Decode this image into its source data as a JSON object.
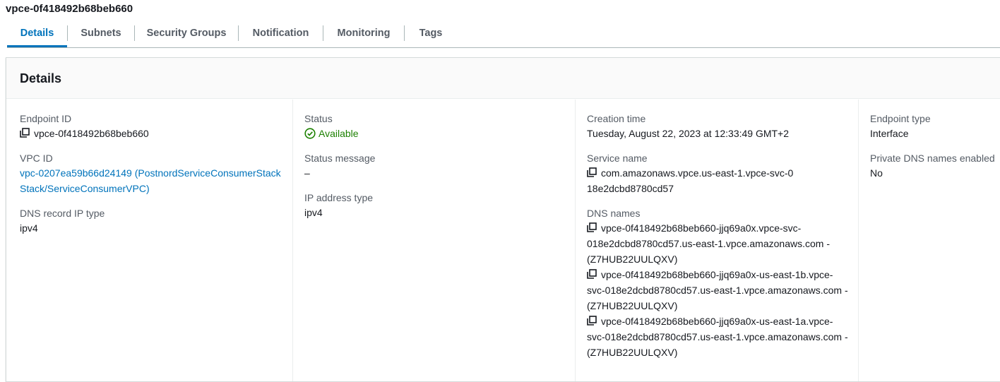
{
  "page": {
    "title": "vpce-0f418492b68beb660"
  },
  "tabs": [
    {
      "label": "Details",
      "active": true
    },
    {
      "label": "Subnets",
      "active": false
    },
    {
      "label": "Security Groups",
      "active": false
    },
    {
      "label": "Notification",
      "active": false
    },
    {
      "label": "Monitoring",
      "active": false
    },
    {
      "label": "Tags",
      "active": false
    }
  ],
  "panel": {
    "heading": "Details"
  },
  "fields": {
    "endpoint_id": {
      "label": "Endpoint ID",
      "value": "vpce-0f418492b68beb660",
      "icon": "copy-icon"
    },
    "vpc_id": {
      "label": "VPC ID",
      "value": "vpc-0207ea59b66d24149 (PostnordServiceConsumerStackStack/ServiceConsumerVPC)"
    },
    "dns_record_ip_type": {
      "label": "DNS record IP type",
      "value": "ipv4"
    },
    "status": {
      "label": "Status",
      "value": "Available",
      "icon": "check-circle-icon",
      "color": "#1d8102"
    },
    "status_message": {
      "label": "Status message",
      "value": "–"
    },
    "ip_address_type": {
      "label": "IP address type",
      "value": "ipv4"
    },
    "creation_time": {
      "label": "Creation time",
      "value": "Tuesday, August 22, 2023 at 12:33:49 GMT+2"
    },
    "service_name": {
      "label": "Service name",
      "value": "com.amazonaws.vpce.us-east-1.vpce-svc-018e2dcbd8780cd57",
      "icon": "copy-icon"
    },
    "dns_names": {
      "label": "DNS names",
      "values": [
        "vpce-0f418492b68beb660-jjq69a0x.vpce-svc-018e2dcbd8780cd57.us-east-1.vpce.amazonaws.com - (Z7HUB22UULQXV)",
        "vpce-0f418492b68beb660-jjq69a0x-us-east-1b.vpce-svc-018e2dcbd8780cd57.us-east-1.vpce.amazonaws.com - (Z7HUB22UULQXV)",
        "vpce-0f418492b68beb660-jjq69a0x-us-east-1a.vpce-svc-018e2dcbd8780cd57.us-east-1.vpce.amazonaws.com - (Z7HUB22UULQXV)"
      ],
      "icon": "copy-icon"
    },
    "endpoint_type": {
      "label": "Endpoint type",
      "value": "Interface"
    },
    "private_dns_enabled": {
      "label": "Private DNS names enabled",
      "value": "No"
    }
  },
  "colors": {
    "accent": "#0073bb",
    "success": "#1d8102",
    "text": "#16191f",
    "label": "#545b64"
  }
}
